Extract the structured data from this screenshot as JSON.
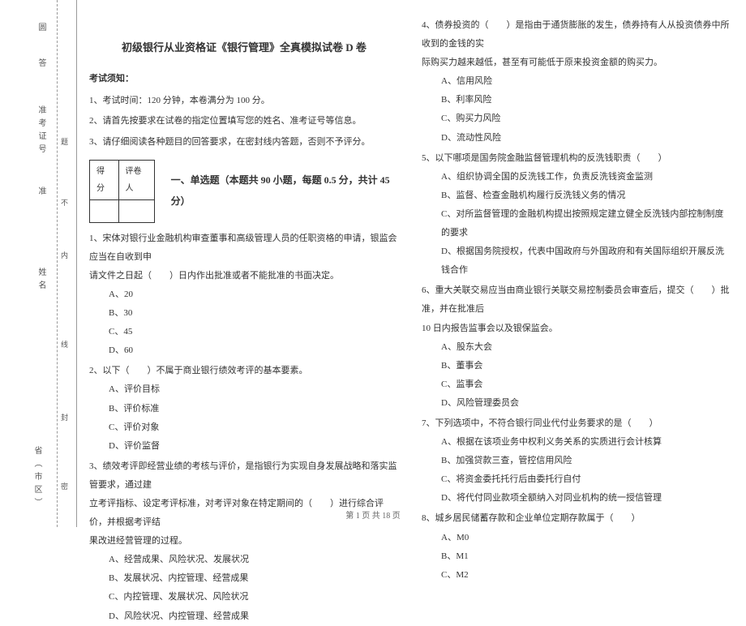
{
  "binding": {
    "lbl1": "圆",
    "lbl2": "答",
    "lbl3": "准考证号",
    "lbl4": "准",
    "lbl6": "姓名",
    "lbl9": "省（市区）",
    "mark1": "题",
    "mark2": "不",
    "mark3": "内",
    "mark4": "线",
    "mark5": "封",
    "mark6": "密"
  },
  "header": {
    "title": "初级银行从业资格证《银行管理》全真模拟试卷 D 卷",
    "notice_title": "考试须知：",
    "notice1": "1、考试时间：120 分钟，本卷满分为 100 分。",
    "notice2": "2、请首先按要求在试卷的指定位置填写您的姓名、准考证号等信息。",
    "notice3": "3、请仔细阅读各种题目的回答要求，在密封线内答题，否则不予评分。"
  },
  "score": {
    "c1": "得分",
    "c2": "评卷人"
  },
  "section1": {
    "header": "一、单选题（本题共 90 小题，每题 0.5 分，共计 45 分）"
  },
  "q1": {
    "text_a": "1、宋体对银行业金融机构审查董事和高级管理人员的任职资格的申请，银监会应当在自收到申",
    "text_b": "请文件之日起（　　）日内作出批准或者不能批准的书面决定。",
    "a": "A、20",
    "b": "B、30",
    "c": "C、45",
    "d": "D、60"
  },
  "q2": {
    "text": "2、以下（　　）不属于商业银行绩效考评的基本要素。",
    "a": "A、评价目标",
    "b": "B、评价标准",
    "c": "C、评价对象",
    "d": "D、评价监督"
  },
  "q3": {
    "text_a": "3、绩效考评即经营业绩的考核与评价，是指银行为实现自身发展战略和落实监管要求，通过建",
    "text_b": "立考评指标、设定考评标准，对考评对象在特定期间的（　　）进行综合评价，并根据考评结",
    "text_c": "果改进经营管理的过程。",
    "a": "A、经营成果、风险状况、发展状况",
    "b": "B、发展状况、内控管理、经营成果",
    "c": "C、内控管理、发展状况、风险状况",
    "d": "D、风险状况、内控管理、经营成果"
  },
  "q4": {
    "text_a": "4、债券投资的（　　）是指由于通货膨胀的发生，债券持有人从投资债券中所收到的金钱的实",
    "text_b": "际购买力越来越低，甚至有可能低于原来投资金额的购买力。",
    "a": "A、信用风险",
    "b": "B、利率风险",
    "c": "C、购买力风险",
    "d": "D、流动性风险"
  },
  "q5": {
    "text": "5、以下哪项是国务院金融监督管理机构的反洗钱职责（　　）",
    "a": "A、组织协调全国的反洗钱工作，负责反洗钱资金监测",
    "b": "B、监督、检查金融机构履行反洗钱义务的情况",
    "c": "C、对所监督管理的金融机构提出按照规定建立健全反洗钱内部控制制度的要求",
    "d": "D、根据国务院授权，代表中国政府与外国政府和有关国际组织开展反洗钱合作"
  },
  "q6": {
    "text_a": "6、重大关联交易应当由商业银行关联交易控制委员会审查后，提交（　　）批准，并在批准后",
    "text_b": "10 日内报告监事会以及银保监会。",
    "a": "A、股东大会",
    "b": "B、董事会",
    "c": "C、监事会",
    "d": "D、风险管理委员会"
  },
  "q7": {
    "text": "7、下列选项中，不符合银行同业代付业务要求的是（　　）",
    "a": "A、根据在该项业务中权利义务关系的实质进行会计核算",
    "b": "B、加强贷款三查，管控信用风险",
    "c": "C、将资金委托托行后由委托行自付",
    "d": "D、将代付同业款项全额纳入对同业机构的统一授信管理"
  },
  "q8": {
    "text": "8、城乡居民储蓄存款和企业单位定期存款属于（　　）",
    "a": "A、M0",
    "b": "B、M1",
    "c": "C、M2"
  },
  "footer": "第 1 页 共 18 页"
}
